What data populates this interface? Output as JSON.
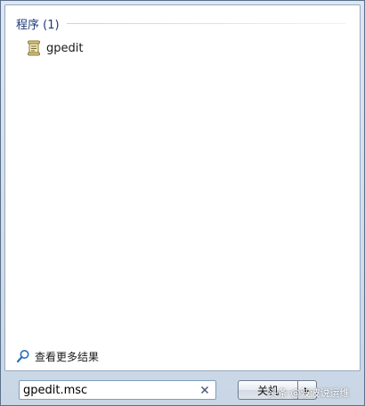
{
  "results": {
    "section_title": "程序 (1)",
    "items": [
      {
        "label": "gpedit",
        "icon": "policy-scroll-icon"
      }
    ],
    "more_results_label": "查看更多结果",
    "more_results_icon": "search-magnifier-icon"
  },
  "search": {
    "value": "gpedit.msc",
    "clear_icon": "clear-x-icon"
  },
  "power": {
    "shutdown_label": "关机",
    "arrow_icon": "triangle-right-icon"
  },
  "watermark": {
    "text": "头条 @波波说运维"
  },
  "colors": {
    "section_title": "#1e3a78",
    "accent_border": "#7f9db9"
  }
}
